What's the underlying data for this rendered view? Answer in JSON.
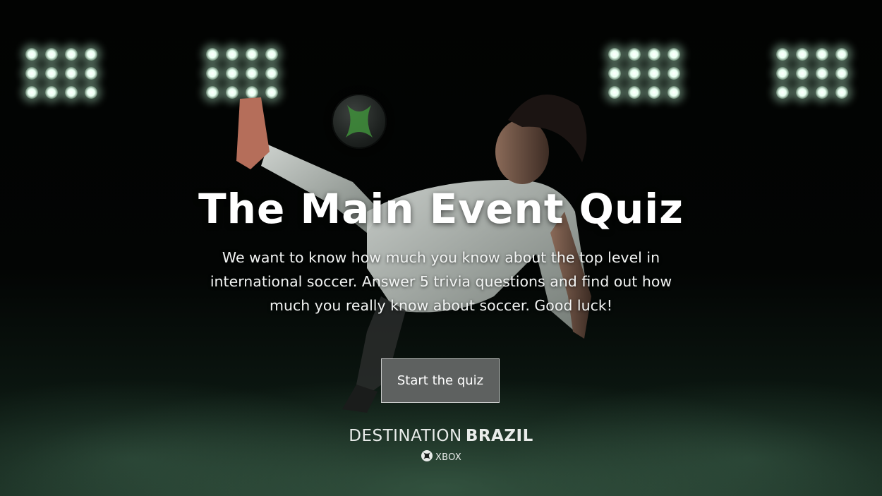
{
  "hero": {
    "title": "The Main Event Quiz",
    "description": "We want to know how much you know about the top level in international soccer. Answer 5 trivia questions and find out how much you really know about soccer. Good luck!"
  },
  "actions": {
    "start_label": "Start the quiz"
  },
  "branding": {
    "destination": "DESTINATION",
    "country": "BRAZIL",
    "platform": "XBOX"
  },
  "colors": {
    "button_bg": "#5e6160",
    "button_border": "#c9cbca",
    "text": "#ffffff",
    "accent_green": "#3cb043"
  }
}
